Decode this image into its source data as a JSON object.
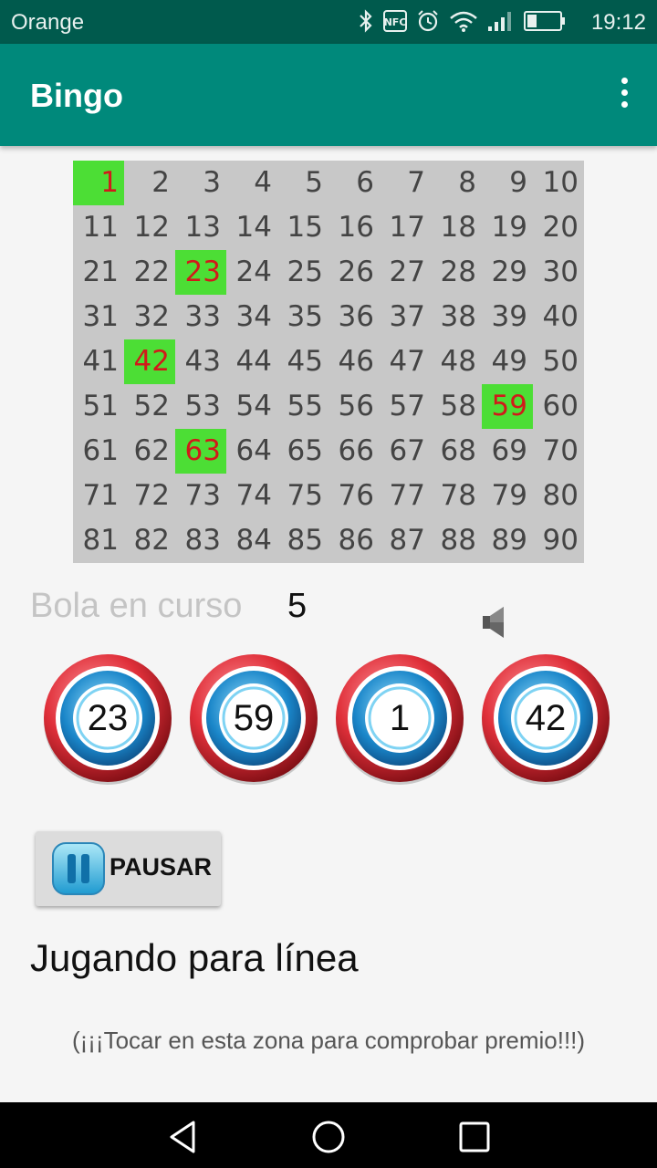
{
  "status_bar": {
    "carrier": "Orange",
    "time": "19:12",
    "icons": [
      "bluetooth-icon",
      "nfc-icon",
      "alarm-icon",
      "wifi-icon",
      "signal-icon",
      "battery-icon"
    ]
  },
  "app_bar": {
    "title": "Bingo"
  },
  "board": {
    "numbers": [
      1,
      2,
      3,
      4,
      5,
      6,
      7,
      8,
      9,
      10,
      11,
      12,
      13,
      14,
      15,
      16,
      17,
      18,
      19,
      20,
      21,
      22,
      23,
      24,
      25,
      26,
      27,
      28,
      29,
      30,
      31,
      32,
      33,
      34,
      35,
      36,
      37,
      38,
      39,
      40,
      41,
      42,
      43,
      44,
      45,
      46,
      47,
      48,
      49,
      50,
      51,
      52,
      53,
      54,
      55,
      56,
      57,
      58,
      59,
      60,
      61,
      62,
      63,
      64,
      65,
      66,
      67,
      68,
      69,
      70,
      71,
      72,
      73,
      74,
      75,
      76,
      77,
      78,
      79,
      80,
      81,
      82,
      83,
      84,
      85,
      86,
      87,
      88,
      89,
      90
    ],
    "drawn": [
      1,
      23,
      42,
      59,
      63
    ]
  },
  "current": {
    "label": "Bola en curso",
    "count": "5"
  },
  "recent_balls": [
    "23",
    "59",
    "1",
    "42"
  ],
  "pause_button": {
    "label": "PAUSAR"
  },
  "mode_text": "Jugando para línea",
  "hint_text": "(¡¡¡Tocar en esta zona para comprobar premio!!!)",
  "colors": {
    "app_bar": "#00897b",
    "status_bar": "#005a4d",
    "drawn_bg": "#4cde35",
    "drawn_text": "#d11a1a",
    "board_bg": "#c8c8c8"
  }
}
